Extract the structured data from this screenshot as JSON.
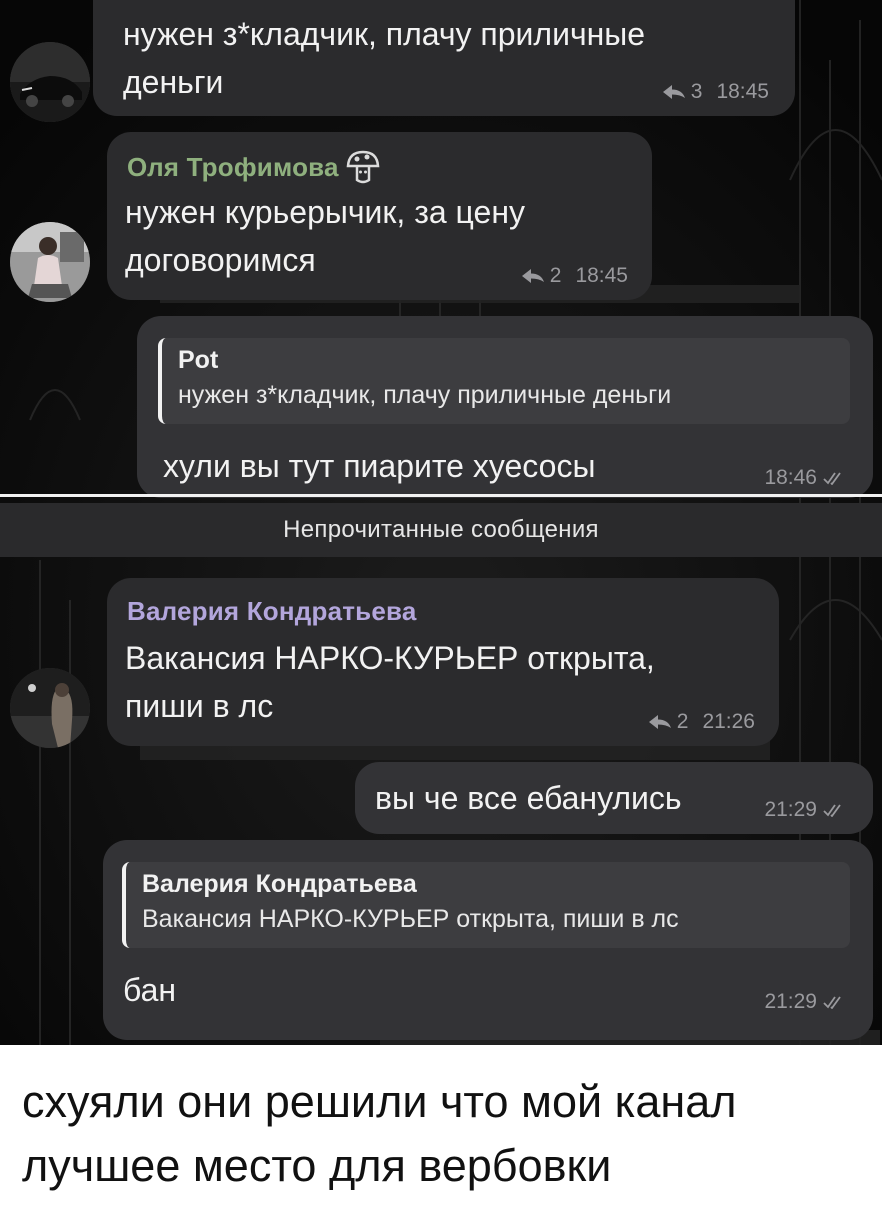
{
  "messages": [
    {
      "text_lines": [
        "нужен з*кладчик, плачу приличные",
        "деньги"
      ],
      "reply_count": "3",
      "time": "18:45",
      "avatar": "car-avatar"
    },
    {
      "sender": "Оля Трофимова",
      "sender_color": "#8fb07e",
      "sender_emoji": "mushroom-icon",
      "text_lines": [
        "нужен курьерычик, за цену",
        "договоримся"
      ],
      "reply_count": "2",
      "time": "18:45",
      "avatar": "girl-avatar"
    },
    {
      "quote_name": "Pot",
      "quote_text": "нужен з*кладчик, плачу приличные деньги",
      "text": "хули вы тут пиарите хуесосы",
      "time": "18:46",
      "status": "read-double-check"
    },
    {
      "sender": "Валерия Кондратьева",
      "sender_color": "#b3a6dc",
      "text_lines": [
        "Вакансия НАРКО-КУРЬЕР открыта,",
        "пиши в лс"
      ],
      "reply_count": "2",
      "time": "21:26",
      "avatar": "night-avatar"
    },
    {
      "text": "вы че все ебанулись",
      "time": "21:29",
      "status": "read-double-check"
    },
    {
      "quote_name": "Валерия Кондратьева",
      "quote_text": "Вакансия НАРКО-КУРЬЕР открыта, пиши в лс",
      "text": "бан",
      "time": "21:29",
      "status": "read-double-check"
    }
  ],
  "unread_divider": "Непрочитанные сообщения",
  "caption": "схуяли они решили что мой канал лучшее место для вербовки",
  "colors": {
    "chat_bg": "#0d0d0d",
    "bubble": "#2b2b2d",
    "meta": "#9a9a9e"
  }
}
